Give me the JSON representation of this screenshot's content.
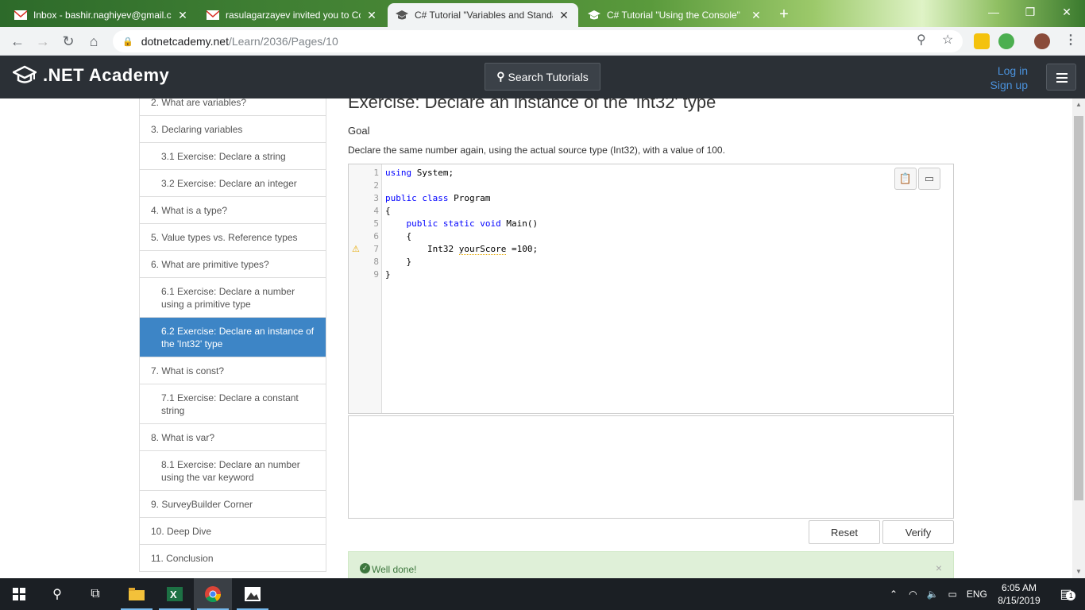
{
  "browser": {
    "tabs": [
      {
        "title": "Inbox - bashir.naghiyev@gmail.com",
        "icon": "gmail-icon",
        "active": false
      },
      {
        "title": "rasulagarzayev invited you to Co",
        "icon": "gmail-icon",
        "active": false
      },
      {
        "title": "C# Tutorial \"Variables and Standa",
        "icon": "graduation-cap-icon",
        "active": true
      },
      {
        "title": "C# Tutorial \"Using the Console\"",
        "icon": "graduation-cap-icon",
        "active": false
      }
    ],
    "url_host": "dotnetcademy.net",
    "url_path": "/Learn/2036/Pages/10"
  },
  "header": {
    "logo_text": ".NET Academy",
    "search_label": "Search Tutorials",
    "login_label": "Log in",
    "signup_label": "Sign up"
  },
  "sidebar": {
    "items": [
      {
        "label": "2. What are variables?",
        "sub": false,
        "active": false
      },
      {
        "label": "3. Declaring variables",
        "sub": false,
        "active": false
      },
      {
        "label": "3.1 Exercise: Declare a string",
        "sub": true,
        "active": false
      },
      {
        "label": "3.2 Exercise: Declare an integer",
        "sub": true,
        "active": false
      },
      {
        "label": "4. What is a type?",
        "sub": false,
        "active": false
      },
      {
        "label": "5. Value types vs. Reference types",
        "sub": false,
        "active": false
      },
      {
        "label": "6. What are primitive types?",
        "sub": false,
        "active": false
      },
      {
        "label": "6.1 Exercise: Declare a number using a primitive type",
        "sub": true,
        "active": false
      },
      {
        "label": "6.2 Exercise: Declare an instance of the 'Int32' type",
        "sub": true,
        "active": true
      },
      {
        "label": "7. What is const?",
        "sub": false,
        "active": false
      },
      {
        "label": "7.1 Exercise: Declare a constant string",
        "sub": true,
        "active": false
      },
      {
        "label": "8. What is var?",
        "sub": false,
        "active": false
      },
      {
        "label": "8.1 Exercise: Declare an number using the var keyword",
        "sub": true,
        "active": false
      },
      {
        "label": "9. SurveyBuilder Corner",
        "sub": false,
        "active": false
      },
      {
        "label": "10. Deep Dive",
        "sub": false,
        "active": false
      },
      {
        "label": "11. Conclusion",
        "sub": false,
        "active": false
      }
    ]
  },
  "exercise": {
    "title": "Exercise: Declare an instance of the 'Int32' type",
    "goal_heading": "Goal",
    "goal_text": "Declare the same number again, using the actual source type (Int32), with a value of 100."
  },
  "editor": {
    "line_numbers": [
      "1",
      "2",
      "3",
      "4",
      "5",
      "6",
      "7",
      "8",
      "9"
    ],
    "warning_line": "7",
    "lines": [
      [
        {
          "t": "using",
          "k": true
        },
        {
          "t": " System;",
          "k": false
        }
      ],
      [],
      [
        {
          "t": "public",
          "k": true
        },
        {
          "t": " ",
          "k": false
        },
        {
          "t": "class",
          "k": true
        },
        {
          "t": " Program",
          "k": false
        }
      ],
      [
        {
          "t": "{",
          "k": false
        }
      ],
      [
        {
          "t": "    ",
          "k": false
        },
        {
          "t": "public",
          "k": true
        },
        {
          "t": " ",
          "k": false
        },
        {
          "t": "static",
          "k": true
        },
        {
          "t": " ",
          "k": false
        },
        {
          "t": "void",
          "k": true
        },
        {
          "t": " Main()",
          "k": false
        }
      ],
      [
        {
          "t": "    {",
          "k": false
        }
      ],
      [
        {
          "t": "        Int32 ",
          "k": false
        },
        {
          "t": "yourScore",
          "k": false,
          "w": true
        },
        {
          "t": " =100;",
          "k": false
        }
      ],
      [
        {
          "t": "    }",
          "k": false
        }
      ],
      [
        {
          "t": "}",
          "k": false
        }
      ]
    ]
  },
  "buttons": {
    "reset_label": "Reset",
    "verify_label": "Verify"
  },
  "alert": {
    "message": "Well done!",
    "close_glyph": "×"
  },
  "taskbar": {
    "language": "ENG",
    "time": "6:05 AM",
    "date": "8/15/2019",
    "notification_count": "1"
  },
  "colors": {
    "header_bg": "#2b3036",
    "accent": "#3d85c6",
    "link": "#4a90d9",
    "success_bg": "#dff0d8",
    "success_text": "#3c763d",
    "keyword": "#0000ff"
  }
}
